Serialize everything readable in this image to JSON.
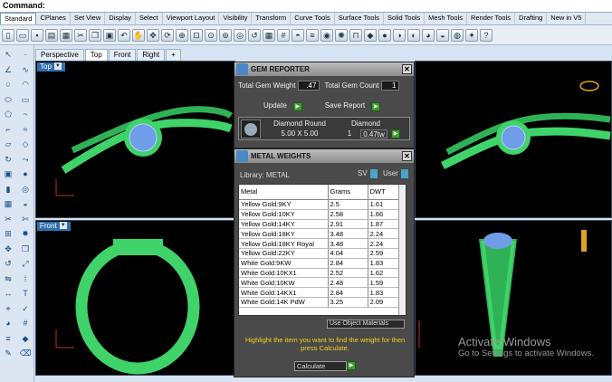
{
  "command": {
    "label": "Command:"
  },
  "menu_tabs": [
    "Standard",
    "CPlanes",
    "Set View",
    "Display",
    "Select",
    "Viewport Layout",
    "Visibility",
    "Transform",
    "Curve Tools",
    "Surface Tools",
    "Solid Tools",
    "Mesh Tools",
    "Render Tools",
    "Drafting",
    "New in V5"
  ],
  "viewport_tabs": [
    "Perspective",
    "Top",
    "Front",
    "Right",
    "+"
  ],
  "viewports": {
    "top": "Top",
    "front": "Front"
  },
  "gem_reporter": {
    "title": "GEM REPORTER",
    "total_weight_label": "Total Gem Weight",
    "total_weight": ".47",
    "total_count_label": "Total Gem Count",
    "total_count": "1",
    "update_label": "Update",
    "save_report_label": "Save Report",
    "gem_name": "Diamond Round",
    "gem_material": "Diamond",
    "gem_size": "5.00 X 5.00",
    "gem_qty": "1",
    "gem_weight": "0.47tw"
  },
  "metal_weights": {
    "title": "METAL WEIGHTS",
    "library_label": "Library: METAL",
    "sv_label": "SV",
    "user_label": "User",
    "columns": [
      "Metal",
      "Grams",
      "DWT"
    ],
    "rows": [
      [
        "Yellow Gold:9KY",
        "2.5",
        "1.61"
      ],
      [
        "Yellow Gold:10KY",
        "2.58",
        "1.66"
      ],
      [
        "Yellow Gold:14KY",
        "2.91",
        "1.87"
      ],
      [
        "Yellow Gold:18KY",
        "3.48",
        "2.24"
      ],
      [
        "Yellow Gold:18KY Royal",
        "3.48",
        "2.24"
      ],
      [
        "Yellow Gold:22KY",
        "4.04",
        "2.59"
      ],
      [
        "White Gold:9KW",
        "2.84",
        "1.83"
      ],
      [
        "White Gold:10KX1",
        "2.52",
        "1.62"
      ],
      [
        "White Gold:10KW",
        "2.48",
        "1.59"
      ],
      [
        "White Gold:14KX1",
        "2.84",
        "1.83"
      ],
      [
        "White Gold:14K PdW",
        "3.25",
        "2.09"
      ]
    ],
    "use_object_materials_label": "Use Object Materials",
    "instruction": "Highlight the item you want to find the weight for then press Calculate.",
    "calculate_label": "Calculate"
  },
  "watermark": {
    "title": "Activate Windows",
    "subtitle": "Go to Settings to activate Windows."
  },
  "colors": {
    "ring_green": "#3fd36a",
    "gem_blue": "#6f9de8",
    "panel_bg": "#4a4a4a",
    "instruction_yellow": "#f2d21a"
  }
}
